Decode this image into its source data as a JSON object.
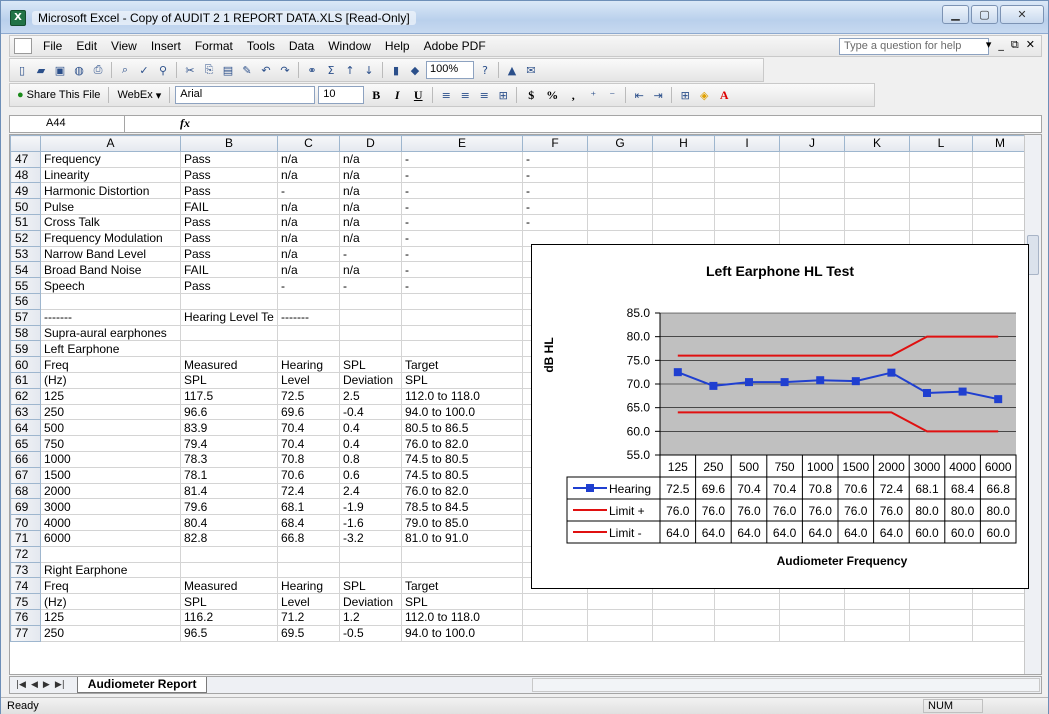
{
  "window": {
    "title": "Microsoft Excel - Copy of AUDIT 2 1 REPORT DATA.XLS  [Read-Only]"
  },
  "menu": [
    "File",
    "Edit",
    "View",
    "Insert",
    "Format",
    "Tools",
    "Data",
    "Window",
    "Help",
    "Adobe PDF"
  ],
  "ask_placeholder": "Type a question for help",
  "toolbar": {
    "zoom": "100%",
    "share": "Share This File",
    "webex": "WebEx",
    "font": "Arial",
    "size": "10"
  },
  "namebox": "A44",
  "columns": [
    "A",
    "B",
    "C",
    "D",
    "E",
    "F",
    "G",
    "H",
    "I",
    "J",
    "K",
    "L",
    "M"
  ],
  "rows": [
    {
      "n": "47",
      "c": [
        "Frequency",
        "Pass",
        "n/a",
        "n/a",
        "-",
        "-"
      ]
    },
    {
      "n": "48",
      "c": [
        "Linearity",
        "Pass",
        "n/a",
        "n/a",
        "-",
        "-"
      ]
    },
    {
      "n": "49",
      "c": [
        "Harmonic Distortion",
        "Pass",
        "-",
        "n/a",
        "-",
        "-"
      ]
    },
    {
      "n": "50",
      "c": [
        "Pulse",
        "FAIL",
        "n/a",
        "n/a",
        "-",
        "-"
      ]
    },
    {
      "n": "51",
      "c": [
        "Cross Talk",
        "Pass",
        "n/a",
        "n/a",
        "-",
        "-"
      ]
    },
    {
      "n": "52",
      "c": [
        "Frequency Modulation",
        "Pass",
        "n/a",
        "n/a",
        "-",
        ""
      ]
    },
    {
      "n": "53",
      "c": [
        "Narrow Band Level",
        "Pass",
        "n/a",
        "-",
        "-",
        ""
      ]
    },
    {
      "n": "54",
      "c": [
        "Broad Band Noise",
        "FAIL",
        "n/a",
        "n/a",
        "-",
        ""
      ]
    },
    {
      "n": "55",
      "c": [
        "Speech",
        "Pass",
        "-",
        "-",
        "-",
        ""
      ]
    },
    {
      "n": "56",
      "c": [
        "",
        "",
        "",
        "",
        "",
        ""
      ]
    },
    {
      "n": "57",
      "c": [
        "-------",
        "Hearing Level Te",
        "-------",
        "",
        "",
        ""
      ]
    },
    {
      "n": "58",
      "c": [
        "Supra-aural earphones",
        "",
        "",
        "",
        "",
        ""
      ]
    },
    {
      "n": "59",
      "c": [
        "Left Earphone",
        "",
        "",
        "",
        "",
        ""
      ]
    },
    {
      "n": "60",
      "c": [
        "Freq",
        "Measured",
        "Hearing",
        "SPL",
        "Target",
        ""
      ]
    },
    {
      "n": "61",
      "c": [
        "(Hz)",
        "SPL",
        "Level",
        "Deviation",
        "SPL",
        ""
      ]
    },
    {
      "n": "62",
      "c": [
        "125",
        "117.5",
        "72.5",
        "2.5",
        "112.0 to 118.0",
        ""
      ]
    },
    {
      "n": "63",
      "c": [
        "250",
        "96.6",
        "69.6",
        "-0.4",
        "94.0 to 100.0",
        ""
      ]
    },
    {
      "n": "64",
      "c": [
        "500",
        "83.9",
        "70.4",
        "0.4",
        "80.5 to 86.5",
        ""
      ]
    },
    {
      "n": "65",
      "c": [
        "750",
        "79.4",
        "70.4",
        "0.4",
        "76.0 to 82.0",
        ""
      ]
    },
    {
      "n": "66",
      "c": [
        "1000",
        "78.3",
        "70.8",
        "0.8",
        "74.5 to 80.5",
        ""
      ]
    },
    {
      "n": "67",
      "c": [
        "1500",
        "78.1",
        "70.6",
        "0.6",
        "74.5 to 80.5",
        ""
      ]
    },
    {
      "n": "68",
      "c": [
        "2000",
        "81.4",
        "72.4",
        "2.4",
        "76.0 to 82.0",
        ""
      ]
    },
    {
      "n": "69",
      "c": [
        "3000",
        "79.6",
        "68.1",
        "-1.9",
        "78.5 to 84.5",
        ""
      ]
    },
    {
      "n": "70",
      "c": [
        "4000",
        "80.4",
        "68.4",
        "-1.6",
        "79.0 to 85.0",
        ""
      ]
    },
    {
      "n": "71",
      "c": [
        "6000",
        "82.8",
        "66.8",
        "-3.2",
        "81.0 to 91.0",
        ""
      ]
    },
    {
      "n": "72",
      "c": [
        "",
        "",
        "",
        "",
        "",
        ""
      ]
    },
    {
      "n": "73",
      "c": [
        "Right Earphone",
        "",
        "",
        "",
        "",
        ""
      ]
    },
    {
      "n": "74",
      "c": [
        "Freq",
        "Measured",
        "Hearing",
        "SPL",
        "Target",
        ""
      ]
    },
    {
      "n": "75",
      "c": [
        "(Hz)",
        "SPL",
        "Level",
        "Deviation",
        "SPL",
        ""
      ]
    },
    {
      "n": "76",
      "c": [
        "125",
        "116.2",
        "71.2",
        "1.2",
        "112.0 to 118.0",
        ""
      ]
    },
    {
      "n": "77",
      "c": [
        "250",
        "96.5",
        "69.5",
        "-0.5",
        "94.0 to 100.0",
        ""
      ]
    }
  ],
  "sheet_tab": "Audiometer Report",
  "status": {
    "ready": "Ready",
    "num": "NUM"
  },
  "chart_data": {
    "type": "line",
    "title": "Left Earphone HL Test",
    "xlabel": "Audiometer Frequency",
    "ylabel": "dB HL",
    "ylim": [
      55,
      85
    ],
    "yticks": [
      "85.0",
      "80.0",
      "75.0",
      "70.0",
      "65.0",
      "60.0",
      "55.0"
    ],
    "categories": [
      "125",
      "250",
      "500",
      "750",
      "1000",
      "1500",
      "2000",
      "3000",
      "4000",
      "6000"
    ],
    "series": [
      {
        "name": "Hearing",
        "color": "#1f3fd0",
        "values": [
          72.5,
          69.6,
          70.4,
          70.4,
          70.8,
          70.6,
          72.4,
          68.1,
          68.4,
          66.8
        ]
      },
      {
        "name": "Limit +",
        "color": "#e01010",
        "values": [
          76.0,
          76.0,
          76.0,
          76.0,
          76.0,
          76.0,
          76.0,
          80.0,
          80.0,
          80.0
        ]
      },
      {
        "name": "Limit -",
        "color": "#e01010",
        "values": [
          64.0,
          64.0,
          64.0,
          64.0,
          64.0,
          64.0,
          64.0,
          60.0,
          60.0,
          60.0
        ]
      }
    ]
  }
}
